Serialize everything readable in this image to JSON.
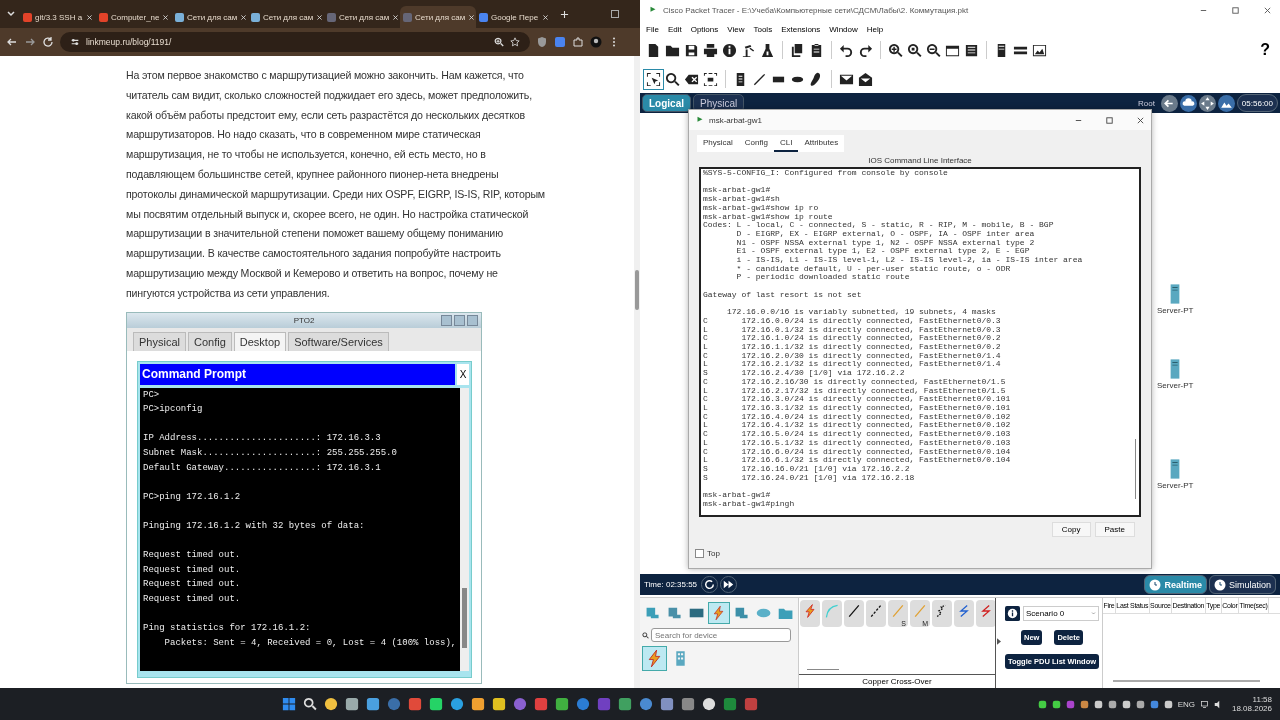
{
  "browser": {
    "tabs": [
      {
        "title": "git/3.3 SSH a",
        "selected": false
      },
      {
        "title": "Computer_ne",
        "selected": false
      },
      {
        "title": "Сети для сам",
        "selected": false
      },
      {
        "title": "Сети для сам",
        "selected": false
      },
      {
        "title": "Сети для сам",
        "selected": false
      },
      {
        "title": "Сети для сам",
        "selected": true
      },
      {
        "title": "Google Пере",
        "selected": false
      }
    ],
    "address": "linkmeup.ru/blog/1191/",
    "article_lines": [
      "На этом первое знакомство с маршрутизацией можно закончить. Нам кажется, что",
      "читатель сам видит, сколько сложностей поджидает его здесь, может предположить,",
      "какой объём работы предстоит ему, если сеть разрастётся до нескольких десятков",
      "маршрутизаторов. Но надо сказать, что в современном мире статическая",
      "маршрутизация, не то чтобы не используется, конечно, ей есть место, но в",
      "подавляющем большинстве сетей, крупнее районного пионер-нета внедрены",
      "протоколы динамической маршрутизации. Среди них OSPF, EIGRP, IS-IS, RIP, которым",
      "мы посвятим отдельный выпуск и, скорее всего, не один. Но настройка статической",
      "маршрутизации в значительной степени поможет вашему общему пониманию",
      "маршрутизации. В качестве самостоятельного задания попробуйте настроить",
      "маршрутизацию между Москвой и Кемерово и ответить на вопрос, почему не",
      "пингуются устройства из сети управления."
    ],
    "pt_window": {
      "title": "PTO2",
      "tabs": [
        {
          "label": "Physical",
          "selected": false
        },
        {
          "label": "Config",
          "selected": false
        },
        {
          "label": "Desktop",
          "selected": true
        },
        {
          "label": "Software/Services",
          "selected": false
        }
      ],
      "prompt_title": "Command Prompt",
      "prompt_close": "X",
      "console": "PC>\nPC>ipconfig\n\nIP Address......................: 172.16.3.3\nSubnet Mask.....................: 255.255.255.0\nDefault Gateway.................: 172.16.3.1\n\nPC>ping 172.16.1.2\n\nPinging 172.16.1.2 with 32 bytes of data:\n\nRequest timed out.\nRequest timed out.\nRequest timed out.\nRequest timed out.\n\nPing statistics for 172.16.1.2:\n    Packets: Sent = 4, Received = 0, Lost = 4 (100% loss),"
    }
  },
  "packet_tracer": {
    "title": "Cisco Packet Tracer - E:\\Учеба\\Компьютерные сети\\СДСМ\\Лабы\\2. Коммутация.pkt",
    "menu": [
      "File",
      "Edit",
      "Options",
      "View",
      "Tools",
      "Extensions",
      "Window",
      "Help"
    ],
    "help": "?",
    "workspace_tabs": [
      {
        "label": "Logical",
        "selected": true
      },
      {
        "label": "Physical",
        "selected": false
      }
    ],
    "root": "Root",
    "clock": "05:56:00",
    "devices": [
      {
        "label": "Server-PT"
      },
      {
        "label": "Server-PT"
      },
      {
        "label": "Server-PT"
      }
    ],
    "dialog": {
      "title": "msk-arbat-gw1",
      "tabs": [
        {
          "label": "Physical",
          "selected": false
        },
        {
          "label": "Config",
          "selected": false
        },
        {
          "label": "CLI",
          "selected": true
        },
        {
          "label": "Attributes",
          "selected": false
        }
      ],
      "heading": "IOS Command Line Interface",
      "cli": "%SYS-5-CONFIG_I: Configured from console by console\n\nmsk-arbat-gw1#\nmsk-arbat-gw1#sh\nmsk-arbat-gw1#show ip ro\nmsk-arbat-gw1#show ip route\nCodes: L - local, C - connected, S - static, R - RIP, M - mobile, B - BGP\n       D - EIGRP, EX - EIGRP external, O - OSPF, IA - OSPF inter area\n       N1 - OSPF NSSA external type 1, N2 - OSPF NSSA external type 2\n       E1 - OSPF external type 1, E2 - OSPF external type 2, E - EGP\n       i - IS-IS, L1 - IS-IS level-1, L2 - IS-IS level-2, ia - IS-IS inter area\n       * - candidate default, U - per-user static route, o - ODR\n       P - periodic downloaded static route\n\nGateway of last resort is not set\n\n     172.16.0.0/16 is variably subnetted, 19 subnets, 4 masks\nC       172.16.0.0/24 is directly connected, FastEthernet0/0.3\nL       172.16.0.1/32 is directly connected, FastEthernet0/0.3\nC       172.16.1.0/24 is directly connected, FastEthernet0/0.2\nL       172.16.1.1/32 is directly connected, FastEthernet0/0.2\nC       172.16.2.0/30 is directly connected, FastEthernet0/1.4\nL       172.16.2.1/32 is directly connected, FastEthernet0/1.4\nS       172.16.2.4/30 [1/0] via 172.16.2.2\nC       172.16.2.16/30 is directly connected, FastEthernet0/1.5\nL       172.16.2.17/32 is directly connected, FastEthernet0/1.5\nC       172.16.3.0/24 is directly connected, FastEthernet0/0.101\nL       172.16.3.1/32 is directly connected, FastEthernet0/0.101\nC       172.16.4.0/24 is directly connected, FastEthernet0/0.102\nL       172.16.4.1/32 is directly connected, FastEthernet0/0.102\nC       172.16.5.0/24 is directly connected, FastEthernet0/0.103\nL       172.16.5.1/32 is directly connected, FastEthernet0/0.103\nC       172.16.6.0/24 is directly connected, FastEthernet0/0.104\nL       172.16.6.1/32 is directly connected, FastEthernet0/0.104\nS       172.16.16.0/21 [1/0] via 172.16.2.2\nS       172.16.24.0/21 [1/0] via 172.16.2.18\n\nmsk-arbat-gw1#\nmsk-arbat-gw1#pingh",
      "buttons": [
        "Copy",
        "Paste"
      ],
      "top": {
        "label": "Top",
        "checked": false
      }
    },
    "time": "Time: 02:35:55",
    "modes": [
      {
        "label": "Realtime",
        "selected": true
      },
      {
        "label": "Simulation",
        "selected": false
      }
    ],
    "categories": [
      {
        "kind": "network",
        "selected": false
      },
      {
        "kind": "end",
        "selected": false
      },
      {
        "kind": "component",
        "selected": false
      },
      {
        "kind": "connection",
        "selected": true
      },
      {
        "kind": "misc",
        "selected": false
      },
      {
        "kind": "multiuser",
        "selected": false
      },
      {
        "kind": "folder",
        "selected": false
      }
    ],
    "search": {
      "placeholder": "Search for device"
    },
    "subcategories": [
      {
        "kind": "connection",
        "selected": true
      },
      {
        "kind": "grid",
        "selected": false
      }
    ],
    "cables": [
      {
        "kind": "auto"
      },
      {
        "kind": "console"
      },
      {
        "kind": "straight"
      },
      {
        "kind": "cross"
      },
      {
        "kind": "serial",
        "mark": "S"
      },
      {
        "kind": "serial",
        "mark": "M"
      },
      {
        "kind": "phone"
      },
      {
        "kind": "coax"
      },
      {
        "kind": "fiber"
      }
    ],
    "cable_name": "Copper Cross-Over",
    "scenario": {
      "value": "Scenario 0",
      "buttons": [
        "New",
        "Delete"
      ],
      "toggle": "Toggle PDU List Window"
    },
    "pdu_columns": [
      "Fire",
      "Last Status",
      "Source",
      "Destination",
      "Type",
      "Color",
      "Time(sec)"
    ]
  },
  "taskbar": {
    "language": "ENG",
    "time": "11:58",
    "date": "18.08.2026"
  }
}
